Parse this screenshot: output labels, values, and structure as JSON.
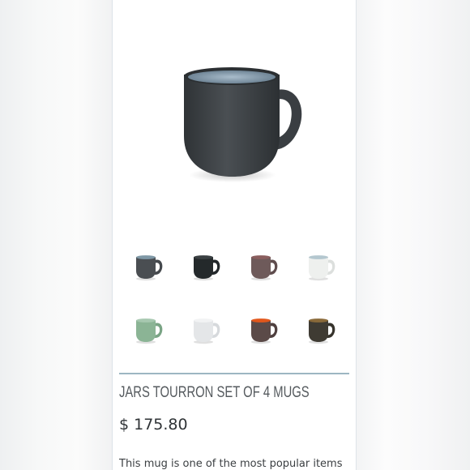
{
  "product": {
    "title": "JARS TOURRON SET OF 4 MUGS",
    "price": "$ 175.80",
    "description": "This mug is one of the most popular items"
  },
  "hero_image": {
    "icon": "mug-icon",
    "body_color": "#3e4246",
    "interior_color": "#8fa5b6",
    "handle_color": "#3a3e42"
  },
  "thumbnails": [
    {
      "name": "grey-speckled",
      "body_color": "#4a4e52",
      "rim_color": "#7f98a6",
      "handle_color": "#45494d"
    },
    {
      "name": "black",
      "body_color": "#24292b",
      "rim_color": "#3a4042",
      "handle_color": "#22272a"
    },
    {
      "name": "plum-brown",
      "body_color": "#6e5a5a",
      "rim_color": "#8a5e5e",
      "handle_color": "#5f4d4e"
    },
    {
      "name": "white",
      "body_color": "#eef0ee",
      "rim_color": "#b4c7cf",
      "handle_color": "#dcdfdd"
    },
    {
      "name": "celadon-green",
      "body_color": "#8bb495",
      "rim_color": "#a7c8b0",
      "handle_color": "#7aa485"
    },
    {
      "name": "pale-white",
      "body_color": "#e4e6e8",
      "rim_color": "#f2f3f4",
      "handle_color": "#d6d9dc"
    },
    {
      "name": "brown-orange",
      "body_color": "#5b4a48",
      "rim_color": "#e2571c",
      "handle_color": "#4f403f"
    },
    {
      "name": "dark-olive",
      "body_color": "#3f3b33",
      "rim_color": "#8a6a3a",
      "handle_color": "#36332c"
    }
  ]
}
